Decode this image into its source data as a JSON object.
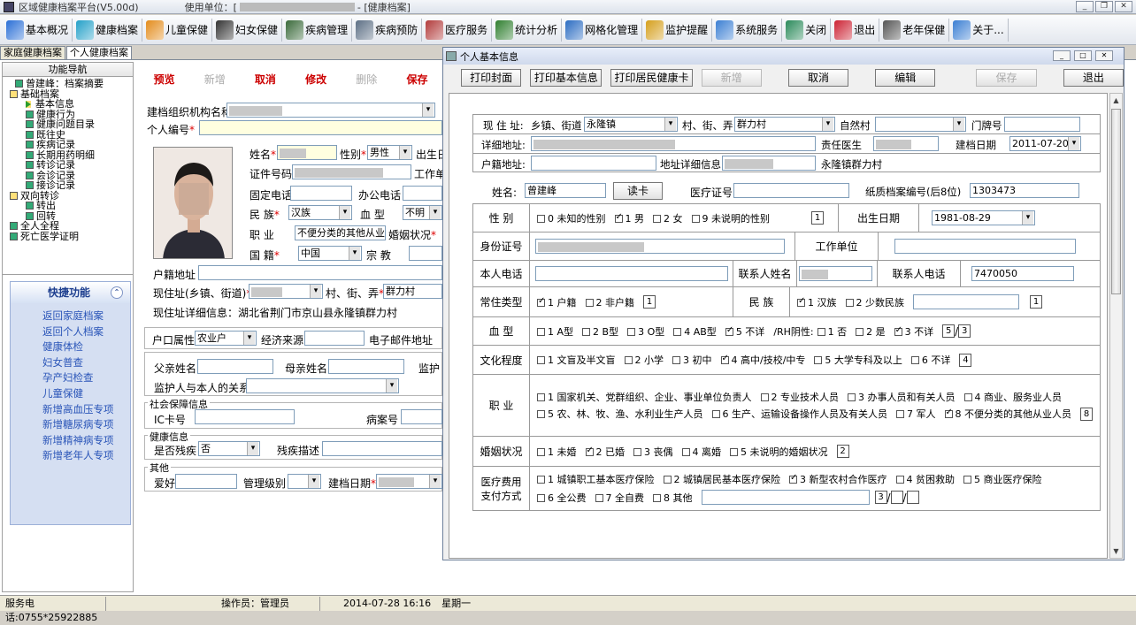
{
  "window": {
    "title": "区域健康档案平台(V5.00d)",
    "unit_label": "使用单位：[",
    "module": "- [健康档案]"
  },
  "toolbar": [
    {
      "label": "基本概况",
      "color": "#2a6fd6"
    },
    {
      "label": "健康档案",
      "color": "#23a0c8"
    },
    {
      "label": "儿童保健",
      "color": "#e38c1c"
    },
    {
      "label": "妇女保健",
      "color": "#333"
    },
    {
      "label": "疾病管理",
      "color": "#3a6a3a"
    },
    {
      "label": "疾病预防",
      "color": "#5c6f85"
    },
    {
      "label": "医疗服务",
      "color": "#b23b3b"
    },
    {
      "label": "统计分析",
      "color": "#2f7f2f"
    },
    {
      "label": "网格化管理",
      "color": "#2b6cc2"
    },
    {
      "label": "监护提醒",
      "color": "#d59f1c"
    },
    {
      "label": "系统服务",
      "color": "#3b7fd3"
    },
    {
      "label": "关闭",
      "color": "#2a8a5a"
    },
    {
      "label": "退出",
      "color": "#c23"
    },
    {
      "label": "老年保健",
      "color": "#555"
    },
    {
      "label": "关于...",
      "color": "#3b7fd3"
    }
  ],
  "tabs": [
    "家庭健康档案",
    "个人健康档案"
  ],
  "nav": {
    "title": "功能导航",
    "tree": [
      "曾建峰：档案摘要",
      "基础档案",
      "基本信息",
      "健康行为",
      "健康问题目录",
      "既往史",
      "疾病记录",
      "长期用药明细",
      "转诊记录",
      "会诊记录",
      "接诊记录",
      "双向转诊",
      "转出",
      "回转",
      "全人全程",
      "死亡医学证明"
    ]
  },
  "quick": {
    "title": "快捷功能",
    "items": [
      "返回家庭档案",
      "返回个人档案",
      "健康体检",
      "妇女普查",
      "孕产妇检查",
      "儿童保健",
      "新增高血压专项",
      "新增糖尿病专项",
      "新增精神病专项",
      "新增老年人专项"
    ]
  },
  "actions": {
    "preview": "预览",
    "add": "新增",
    "cancel": "取消",
    "modify": "修改",
    "delete": "删除",
    "save": "保存"
  },
  "form": {
    "org_label": "建档组织机构名称",
    "id_label": "个人编号",
    "name_label": "姓名",
    "sex_label": "性别",
    "sex_value": "男性",
    "birth_label": "出生日",
    "cert_label": "证件号码",
    "work_label": "工作单",
    "phone_label": "固定电话",
    "office_label": "办公电话",
    "ethnic_label": "民 族",
    "ethnic_value": "汉族",
    "blood_label": "血 型",
    "blood_value": "不明",
    "job_label": "职 业",
    "job_value": "不便分类的其他从业",
    "marriage_label": "婚姻状况",
    "nation_label": "国 籍",
    "nation_value": "中国",
    "religion_label": "宗 教",
    "huji_label": "户籍地址",
    "addr_label": "现住址(乡镇、街道)",
    "village_label": "村、街、弄",
    "village_value": "群力村",
    "addr_detail": "现住址详细信息：湖北省荆门市京山县永隆镇群力村",
    "hukou_label": "户口属性",
    "hukou_value": "农业户",
    "econ_label": "经济来源",
    "email_label": "电子邮件地址",
    "father_label": "父亲姓名",
    "mother_label": "母亲姓名",
    "guard_label": "监护",
    "guard_rel_label": "监护人与本人的关系",
    "social_title": "社会保障信息",
    "ic_label": "IC卡号",
    "case_label": "病案号",
    "health_title": "健康信息",
    "disabled_label": "是否残疾",
    "disabled_value": "否",
    "disabled_desc": "残疾描述",
    "other_title": "其他",
    "hobby_label": "爱好",
    "manage_label": "管理级别",
    "date_label": "建档日期"
  },
  "dialog": {
    "title": "个人基本信息",
    "buttons": [
      {
        "label": "打印封面",
        "disabled": false
      },
      {
        "label": "打印基本信息",
        "disabled": false
      },
      {
        "label": "打印居民健康卡",
        "disabled": false
      },
      {
        "label": "新增",
        "disabled": true
      },
      {
        "label": "取消",
        "disabled": false
      },
      {
        "label": "编辑",
        "disabled": false
      },
      {
        "label": "保存",
        "disabled": true
      },
      {
        "label": "退出",
        "disabled": false
      }
    ],
    "addr_label": "现 住 址:",
    "town_label": "乡镇、街道",
    "town_value": "永隆镇",
    "village_label": "村、街、弄",
    "village_value": "群力村",
    "natural_label": "自然村",
    "door_label": "门牌号",
    "detail_label": "详细地址:",
    "doctor_label": "责任医生",
    "date_label": "建档日期",
    "date_value": "2011-07-20",
    "huji_label": "户籍地址:",
    "huji_detail_label": "地址详细信息",
    "huji_detail_value": "永隆镇群力村",
    "name_label": "姓名:",
    "name_value": "曾建峰",
    "read_card": "读卡",
    "med_no_label": "医疗证号",
    "paper_label": "纸质档案编号(后8位)",
    "paper_value": "1303473",
    "sex": {
      "label": "性 别",
      "options": [
        {
          "t": "0 未知的性别",
          "on": false
        },
        {
          "t": "1 男",
          "on": true
        },
        {
          "t": "2 女",
          "on": false
        },
        {
          "t": "9 未说明的性别",
          "on": false
        }
      ],
      "code": "1",
      "birth_label": "出生日期",
      "birth_value": "1981-08-29"
    },
    "id_label": "身份证号",
    "work_label": "工作单位",
    "tel_label": "本人电话",
    "contact_label": "联系人姓名",
    "contact_tel_label": "联系人电话",
    "contact_tel_value": "7470050",
    "reside": {
      "label": "常住类型",
      "options": [
        {
          "t": "1 户籍",
          "on": true
        },
        {
          "t": "2 非户籍",
          "on": false
        }
      ],
      "code": "1"
    },
    "ethnic": {
      "label": "民 族",
      "options": [
        {
          "t": "1 汉族",
          "on": true
        },
        {
          "t": "2 少数民族",
          "on": false
        }
      ],
      "code": "1"
    },
    "blood": {
      "label": "血 型",
      "options": [
        {
          "t": "1 A型",
          "on": false
        },
        {
          "t": "2 B型",
          "on": false
        },
        {
          "t": "3 O型",
          "on": false
        },
        {
          "t": "4 AB型",
          "on": false
        },
        {
          "t": "5 不详",
          "on": true
        }
      ],
      "rh_label": "/RH阴性:",
      "rh": [
        {
          "t": "1 否",
          "on": false
        },
        {
          "t": "2 是",
          "on": false
        },
        {
          "t": "3 不详",
          "on": true
        }
      ],
      "code": "5",
      "code2": "3"
    },
    "edu": {
      "label": "文化程度",
      "options": [
        {
          "t": "1 文盲及半文盲",
          "on": false
        },
        {
          "t": "2 小学",
          "on": false
        },
        {
          "t": "3 初中",
          "on": false
        },
        {
          "t": "4 高中/技校/中专",
          "on": true
        },
        {
          "t": "5 大学专科及以上",
          "on": false
        },
        {
          "t": "6 不详",
          "on": false
        }
      ],
      "code": "4"
    },
    "job": {
      "label": "职 业",
      "options": [
        {
          "t": "1 国家机关、党群组织、企业、事业单位负责人",
          "on": false
        },
        {
          "t": "2 专业技术人员",
          "on": false
        },
        {
          "t": "3 办事人员和有关人员",
          "on": false
        },
        {
          "t": "4 商业、服务业人员",
          "on": false
        },
        {
          "t": "5 农、林、牧、渔、水利业生产人员",
          "on": false
        },
        {
          "t": "6 生产、运输设备操作人员及有关人员",
          "on": false
        },
        {
          "t": "7 军人",
          "on": false
        },
        {
          "t": "8 不便分类的其他从业人员",
          "on": true
        }
      ],
      "code": "8"
    },
    "marry": {
      "label": "婚姻状况",
      "options": [
        {
          "t": "1 未婚",
          "on": false
        },
        {
          "t": "2 已婚",
          "on": true
        },
        {
          "t": "3 丧偶",
          "on": false
        },
        {
          "t": "4 离婚",
          "on": false
        },
        {
          "t": "5 未说明的婚姻状况",
          "on": false
        }
      ],
      "code": "2"
    },
    "pay": {
      "label1": "医疗费用",
      "label2": "支付方式",
      "options": [
        {
          "t": "1 城镇职工基本医疗保险",
          "on": false
        },
        {
          "t": "2 城镇居民基本医疗保险",
          "on": false
        },
        {
          "t": "3 新型农村合作医疗",
          "on": true
        },
        {
          "t": "4 贫困救助",
          "on": false
        },
        {
          "t": "5 商业医疗保险",
          "on": false
        },
        {
          "t": "6 全公费",
          "on": false
        },
        {
          "t": "7 全自费",
          "on": false
        },
        {
          "t": "8 其他",
          "on": false
        }
      ],
      "code": "3"
    }
  },
  "status": {
    "phone": "服务电话:0755*25922885",
    "operator": "操作员：管理员",
    "datetime": "2014-07-28 16:16",
    "weekday": "星期一"
  }
}
